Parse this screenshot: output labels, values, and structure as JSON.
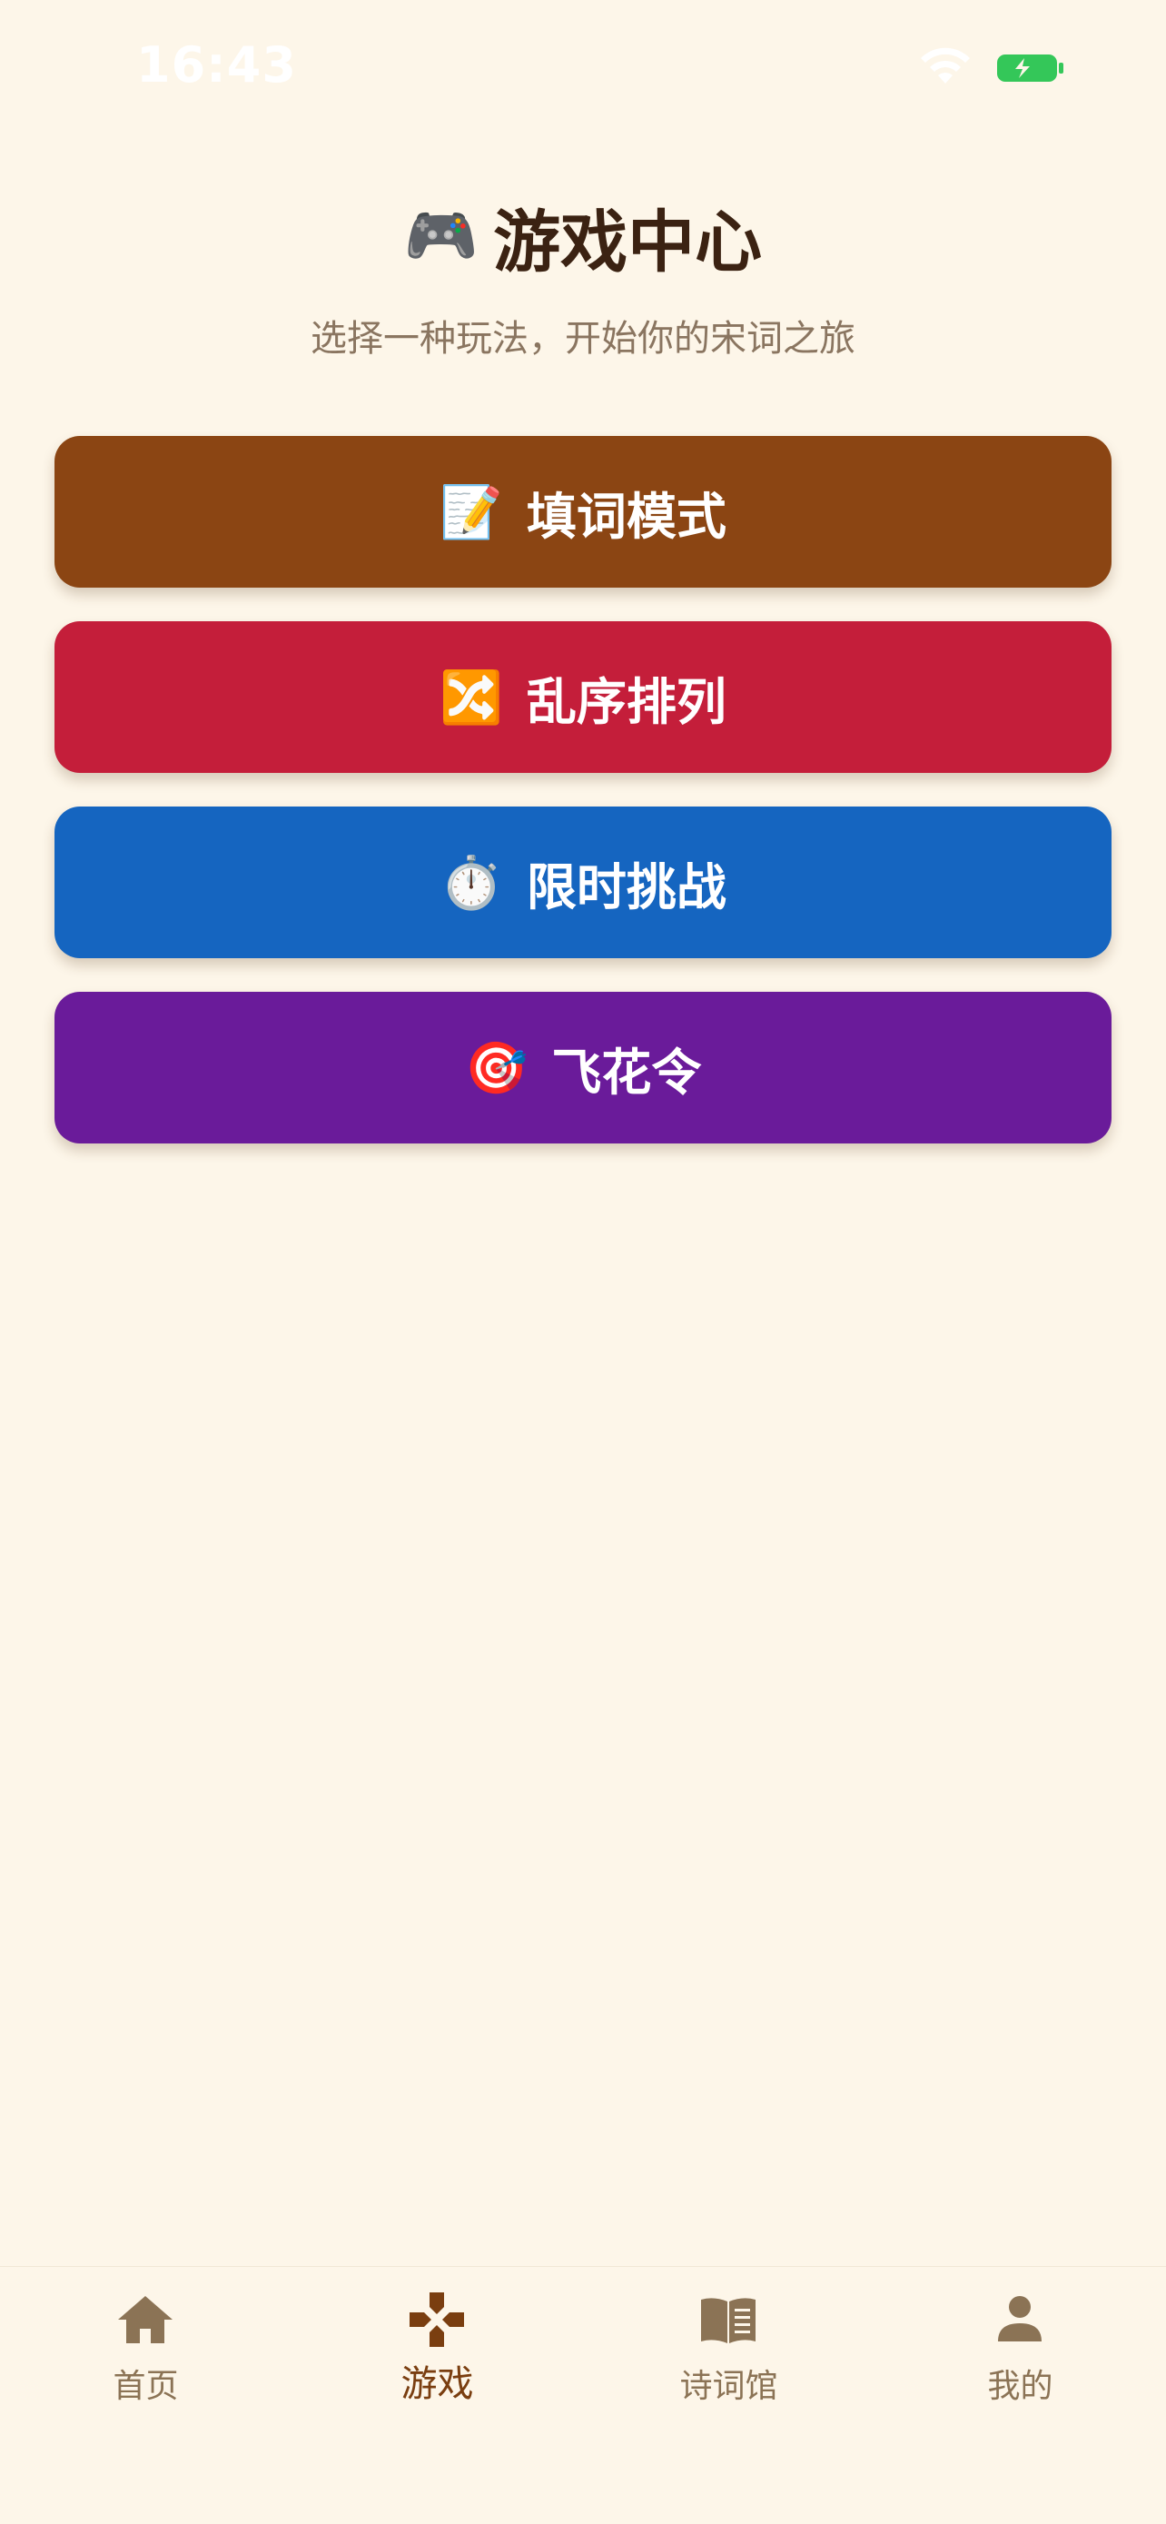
{
  "status_bar": {
    "time": "16:43"
  },
  "header": {
    "title_emoji": "🎮",
    "title": "游戏中心",
    "subtitle": "选择一种玩法，开始你的宋词之旅"
  },
  "modes": [
    {
      "emoji": "📝",
      "label": "填词模式",
      "color": "#8B4513"
    },
    {
      "emoji": "🔀",
      "label": "乱序排列",
      "color": "#C41E3A"
    },
    {
      "emoji": "⏱️",
      "label": "限时挑战",
      "color": "#1565C0"
    },
    {
      "emoji": "🎯",
      "label": "飞花令",
      "color": "#6A1B9A"
    }
  ],
  "tab_bar": {
    "items": [
      {
        "icon": "home-icon",
        "label": "首页",
        "active": false
      },
      {
        "icon": "game-icon",
        "label": "游戏",
        "active": true
      },
      {
        "icon": "book-icon",
        "label": "诗词馆",
        "active": false
      },
      {
        "icon": "person-icon",
        "label": "我的",
        "active": false
      }
    ],
    "active_color": "#7A3E10",
    "inactive_color": "#8B7355"
  },
  "colors": {
    "background": "#FDF6E9",
    "title": "#3B2212",
    "subtitle": "#8A7560",
    "battery": "#34C759"
  }
}
